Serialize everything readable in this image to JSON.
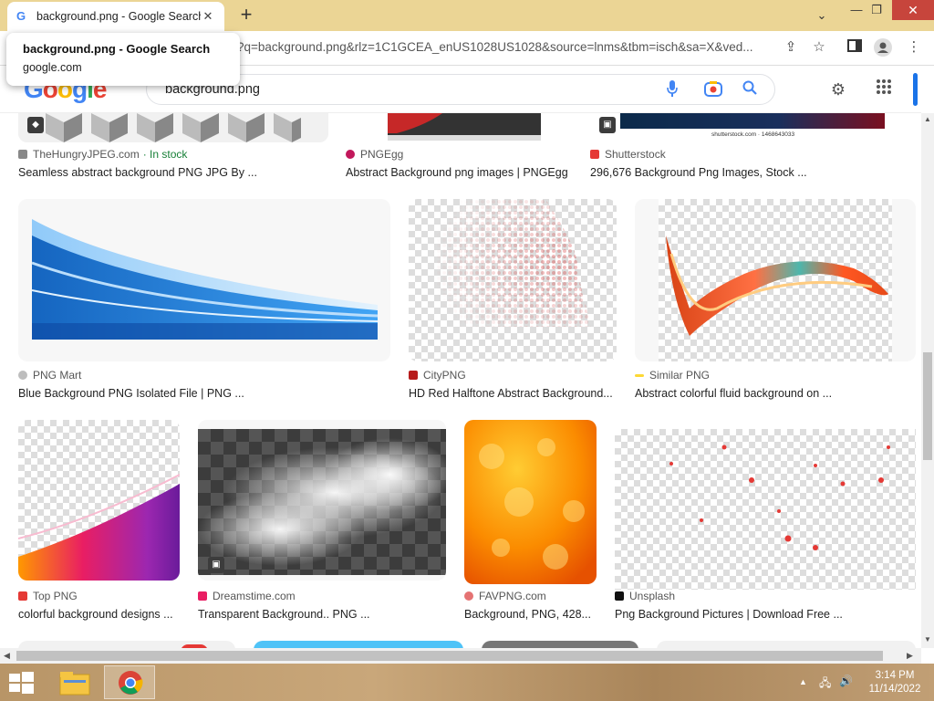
{
  "browser": {
    "tab_title": "background.png - Google Search",
    "tab_favicon": "G",
    "new_tab": "+",
    "url": "?q=background.png&rlz=1C1GCEA_enUS1028US1028&source=lnms&tbm=isch&sa=X&ved...",
    "tooltip_title": "background.png - Google Search",
    "tooltip_domain": "google.com"
  },
  "google": {
    "logo_letters": [
      "G",
      "o",
      "o",
      "g",
      "l",
      "e"
    ],
    "logo_colors": [
      "#4285f4",
      "#ea4335",
      "#fbbc05",
      "#4285f4",
      "#34a853",
      "#ea4335"
    ],
    "query": "background.png"
  },
  "results": [
    {
      "source": "TheHungryJPEG.com",
      "stock": "· In stock",
      "title": "Seamless abstract background PNG JPG By ...",
      "source_color": "#888"
    },
    {
      "source": "PNGEgg",
      "title": "Abstract Background png images | PNGEgg",
      "source_color": "#c2185b"
    },
    {
      "source": "Shutterstock",
      "title": "296,676 Background Png Images, Stock ...",
      "source_color": "#e53935",
      "watermark": "shutterstock.com · 1468643033"
    },
    {
      "source": "PNG Mart",
      "title": "Blue Background PNG Isolated File | PNG ...",
      "source_color": "#9e9e9e"
    },
    {
      "source": "CityPNG",
      "title": "HD Red Halftone Abstract Background...",
      "source_color": "#d32f2f"
    },
    {
      "source": "Similar PNG",
      "title": "Abstract colorful fluid background on ...",
      "source_color": "#f9a825"
    },
    {
      "source": "Top PNG",
      "title": "colorful background designs ...",
      "source_color": "#e53935"
    },
    {
      "source": "Dreamstime.com",
      "title": "Transparent Background.. PNG ...",
      "source_color": "#e91e63"
    },
    {
      "source": "FAVPNG.com",
      "title": "Background, PNG, 428...",
      "source_color": "#e57373"
    },
    {
      "source": "Unsplash",
      "title": "Png Background Pictures | Download Free ...",
      "source_color": "#111"
    }
  ],
  "taskbar": {
    "time": "3:14 PM",
    "date": "11/14/2022"
  }
}
